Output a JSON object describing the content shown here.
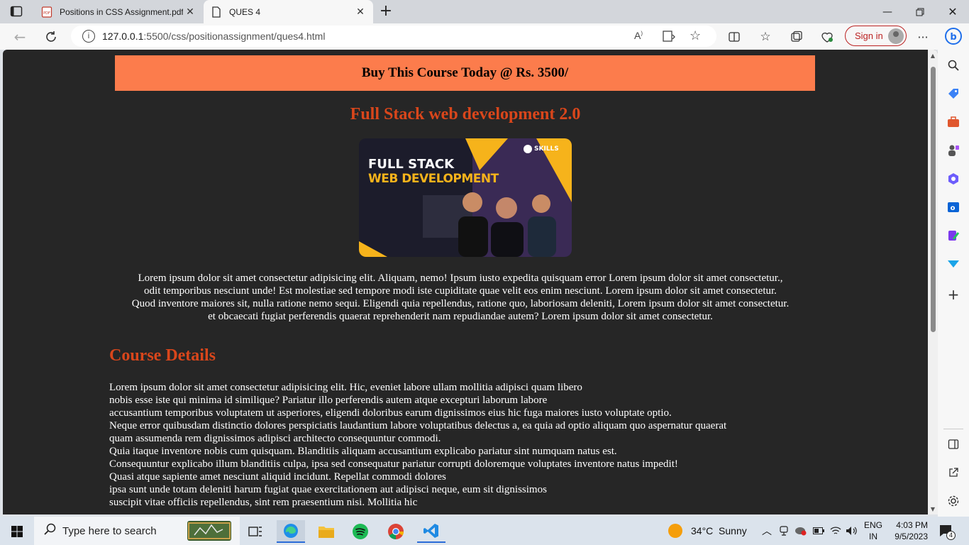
{
  "browser": {
    "tabs": [
      {
        "label": "Positions in CSS Assignment.pdf"
      },
      {
        "label": "QUES 4"
      }
    ],
    "url_host": "127.0.0.1",
    "url_path": ":5500/css/positionassignment/ques4.html",
    "sign_in_label": "Sign in"
  },
  "page": {
    "banner": "Buy This Course Today @ Rs. 3500/",
    "title": "Full Stack web development 2.0",
    "hero": {
      "line1": "FULL STACK",
      "line2": "WEB DEVELOPMENT",
      "brand": "SKILLS"
    },
    "intro": [
      "Lorem ipsum dolor sit amet consectetur adipisicing elit. Aliquam, nemo! Ipsum iusto expedita quisquam error Lorem ipsum dolor sit amet consectetur.,",
      "odit temporibus nesciunt unde! Est molestiae sed tempore modi iste cupiditate quae velit eos enim nesciunt. Lorem ipsum dolor sit amet consectetur.",
      "Quod inventore maiores sit, nulla ratione nemo sequi. Eligendi quia repellendus, ratione quo, laboriosam deleniti, Lorem ipsum dolor sit amet consectetur.",
      "et obcaecati fugiat perferendis quaerat reprehenderit nam repudiandae autem? Lorem ipsum dolor sit amet consectetur."
    ],
    "details_heading": "Course Details",
    "details": [
      "Lorem ipsum dolor sit amet consectetur adipisicing elit. Hic, eveniet labore ullam mollitia adipisci quam libero",
      "nobis esse iste qui minima id similique? Pariatur illo perferendis autem atque excepturi laborum labore",
      "accusantium temporibus voluptatem ut asperiores, eligendi doloribus earum dignissimos eius hic fuga maiores iusto voluptate optio.",
      "Neque error quibusdam distinctio dolores perspiciatis laudantium labore voluptatibus delectus a, ea quia ad optio aliquam quo aspernatur quaerat",
      "quam assumenda rem dignissimos adipisci architecto consequuntur commodi.",
      "Quia itaque inventore nobis cum quisquam. Blanditiis aliquam accusantium explicabo pariatur sint numquam natus est.",
      "Consequuntur explicabo illum blanditiis culpa, ipsa sed consequatur pariatur corrupti doloremque voluptates inventore natus impedit!",
      "Quasi atque sapiente amet nesciunt aliquid incidunt. Repellat commodi dolores",
      "ipsa sunt unde totam deleniti harum fugiat quae exercitationem aut adipisci neque, eum sit dignissimos",
      "suscipit vitae officiis repellendus, sint rem praesentium nisi. Mollitia hic"
    ]
  },
  "taskbar": {
    "search_placeholder": "Type here to search",
    "weather": "34°C  Sunny",
    "lang1": "ENG",
    "lang2": "IN",
    "time": "4:03 PM",
    "date": "9/5/2023",
    "notifications": "4"
  },
  "colors": {
    "banner_bg": "#fc7c4c",
    "heading": "#d9461b",
    "page_bg": "#262626"
  }
}
